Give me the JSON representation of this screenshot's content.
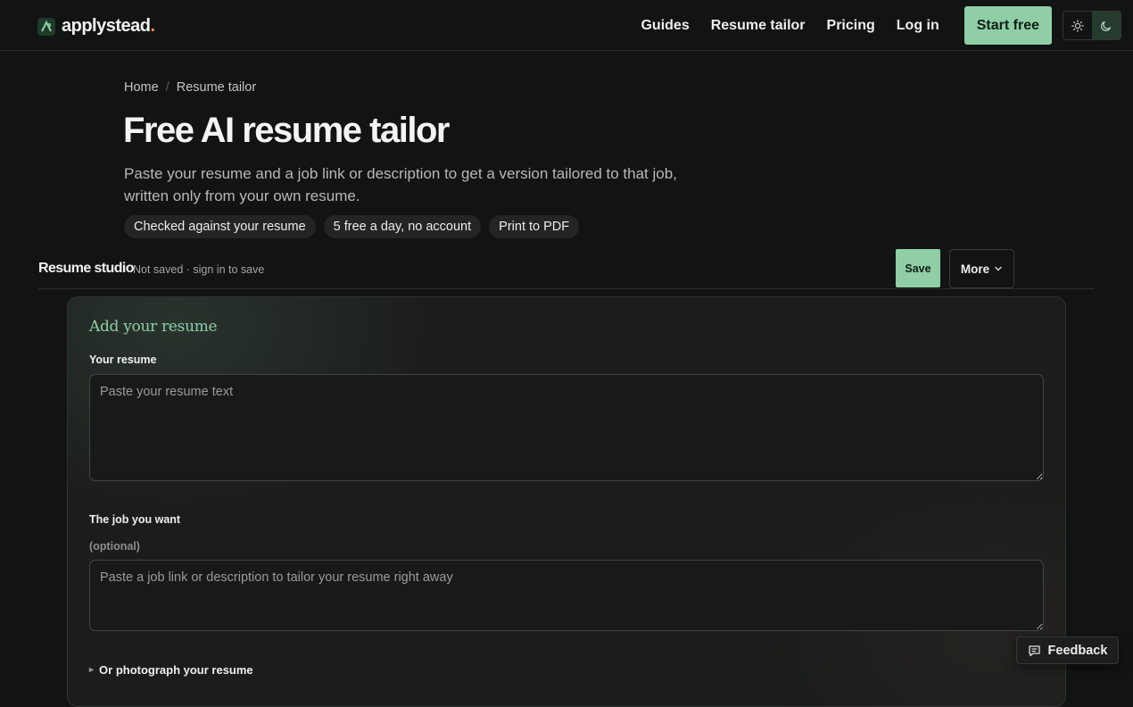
{
  "header": {
    "brand_name": "applystead",
    "brand_dot": ".",
    "nav": [
      "Guides",
      "Resume tailor",
      "Pricing",
      "Log in"
    ],
    "cta_label": "Start free",
    "theme_icons": [
      "sun-icon",
      "moon-icon"
    ],
    "active_theme": "dark"
  },
  "breadcrumb": {
    "items": [
      "Home",
      "Resume tailor"
    ],
    "separator": "/"
  },
  "hero": {
    "title": "Free AI resume tailor",
    "subtitle": "Paste your resume and a job link or description to get a version tailored to that job, written only from your own resume.",
    "pills": [
      "Checked against your resume",
      "5 free a day, no account",
      "Print to PDF"
    ]
  },
  "studio": {
    "title": "Resume studio",
    "status": "Not saved · sign in to save",
    "save_label": "Save",
    "more_label": "More"
  },
  "card": {
    "title": "Add your resume",
    "resume_label": "Your resume",
    "resume_placeholder": "Paste your resume text",
    "job_label": "The job you want",
    "job_note": "(optional)",
    "job_placeholder": "Paste a job link or description to tailor your resume right away",
    "photo_label": "Or photograph your resume"
  },
  "feedback": {
    "label": "Feedback"
  },
  "colors": {
    "accent": "#8fcea6",
    "background": "#121313",
    "card": "#1b1d1c"
  }
}
